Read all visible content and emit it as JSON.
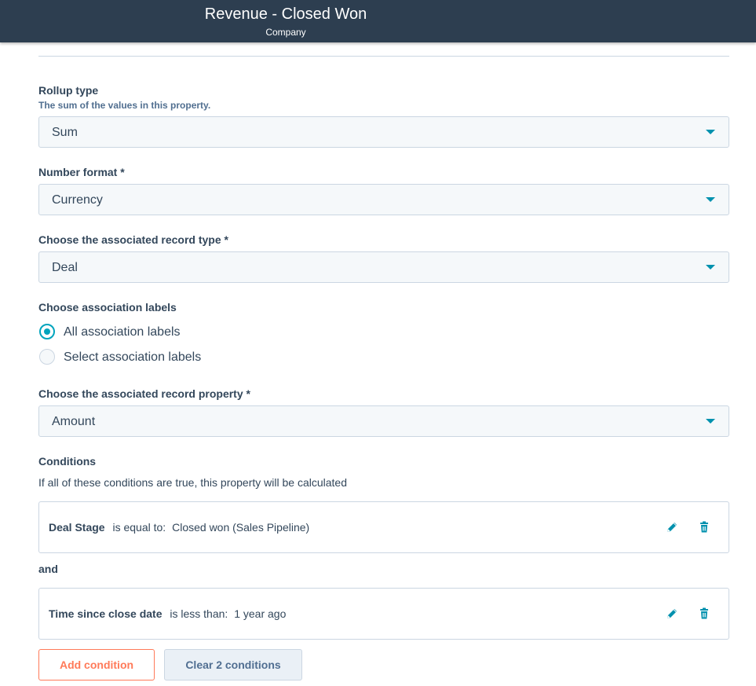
{
  "header": {
    "title": "Revenue - Closed Won",
    "subtitle": "Company"
  },
  "rollup": {
    "label": "Rollup type",
    "help": "The sum of the values in this property.",
    "value": "Sum"
  },
  "number_format": {
    "label": "Number format *",
    "value": "Currency"
  },
  "record_type": {
    "label": "Choose the associated record type *",
    "value": "Deal"
  },
  "association_labels": {
    "label": "Choose association labels",
    "options": [
      {
        "label": "All association labels",
        "selected": true
      },
      {
        "label": "Select association labels",
        "selected": false
      }
    ]
  },
  "record_property": {
    "label": "Choose the associated record property *",
    "value": "Amount"
  },
  "conditions": {
    "label": "Conditions",
    "description": "If all of these conditions are true, this property will be calculated",
    "joiner": "and",
    "items": [
      {
        "property": "Deal Stage",
        "operator": "is equal to:",
        "value": "Closed won (Sales Pipeline)"
      },
      {
        "property": "Time since close date",
        "operator": "is less than:",
        "value": "1 year ago"
      }
    ]
  },
  "buttons": {
    "add": "Add condition",
    "clear": "Clear 2 conditions"
  },
  "colors": {
    "header_bg": "#2d3e50",
    "accent": "#00a4bd",
    "action": "#ff7a59"
  },
  "icons": {
    "select_caret": "caret-down-icon",
    "edit": "pencil-icon",
    "delete": "trash-icon"
  }
}
